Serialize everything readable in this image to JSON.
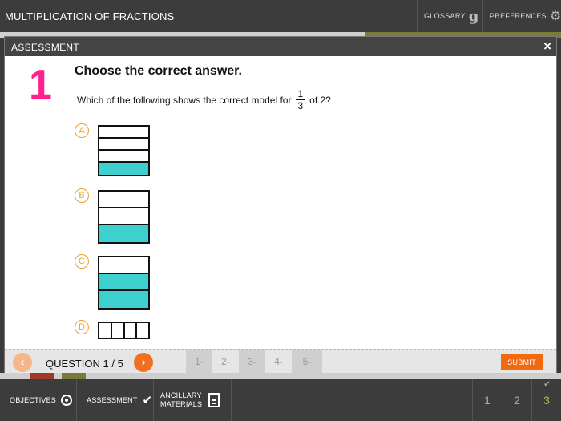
{
  "app": {
    "title": "MULTIPLICATION OF FRACTIONS"
  },
  "top_nav": {
    "glossary_label": "GLOSSARY",
    "glossary_icon": "g",
    "preferences_label": "PREFERENCES"
  },
  "modal": {
    "title": "ASSESSMENT",
    "close_icon": "×",
    "question": {
      "number": "1",
      "heading": "Choose the correct answer.",
      "text_before": "Which of the following shows the correct model for",
      "fraction_num": "1",
      "fraction_den": "3",
      "text_after": "of 2?"
    },
    "options": [
      {
        "letter": "A",
        "parts": 4,
        "shaded": 1
      },
      {
        "letter": "B",
        "parts": 3,
        "shaded": 1
      },
      {
        "letter": "C",
        "parts": 3,
        "shaded": 2
      },
      {
        "letter": "D",
        "parts": 4,
        "shaded": 0
      }
    ],
    "footer": {
      "prev_icon": "‹",
      "next_icon": "›",
      "counter": "QUESTION 1 / 5",
      "pages": [
        "1-",
        "2-",
        "3-",
        "4-",
        "5-"
      ],
      "submit_label": "SUBMIT"
    }
  },
  "bottom_nav": {
    "objectives_label": "OBJECTIVES",
    "assessment_label": "ASSESSMENT",
    "assessment_icon": "✔",
    "ancillary_line1": "ANCILLARY",
    "ancillary_line2": "MATERIALS",
    "sections": [
      "1",
      "2",
      "3"
    ],
    "completed_tick": "✔"
  },
  "colors": {
    "accent": "#f26a10",
    "question_number": "#ff1f8f",
    "shade": "#3ecfcf",
    "option_ring": "#f0a030"
  }
}
